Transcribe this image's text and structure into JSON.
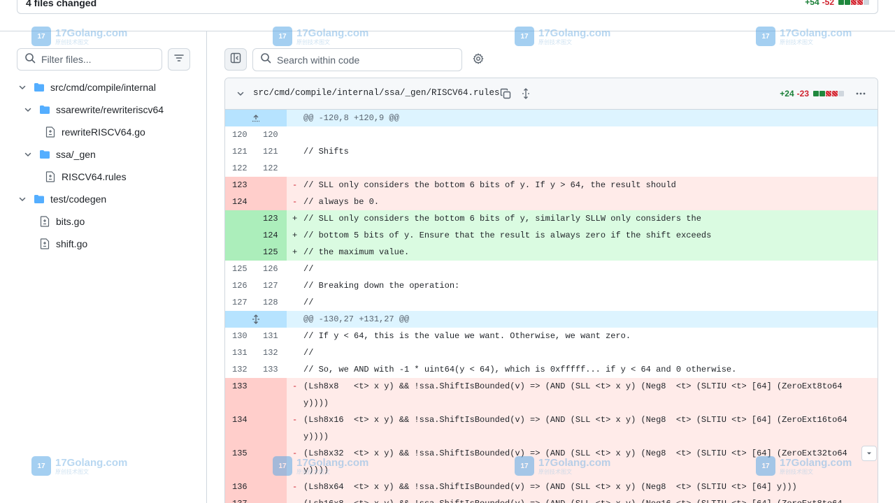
{
  "summary": {
    "files_changed": "4 files changed",
    "additions": "+54",
    "deletions": "-52"
  },
  "sidebar": {
    "filter_placeholder": "Filter files...",
    "tree": [
      {
        "label": "src/cmd/compile/internal",
        "type": "folder"
      },
      {
        "label": "ssarewrite/rewriteriscv64",
        "type": "folder"
      },
      {
        "label": "rewriteRISCV64.go",
        "type": "file"
      },
      {
        "label": "ssa/_gen",
        "type": "folder"
      },
      {
        "label": "RISCV64.rules",
        "type": "file"
      },
      {
        "label": "test/codegen",
        "type": "folder"
      },
      {
        "label": "bits.go",
        "type": "file"
      },
      {
        "label": "shift.go",
        "type": "file"
      }
    ]
  },
  "toolbar": {
    "search_placeholder": "Search within code"
  },
  "file": {
    "path": "src/cmd/compile/internal/ssa/_gen/RISCV64.rules",
    "additions": "+24",
    "deletions": "-23"
  },
  "diff_rows": [
    {
      "kind": "hunk",
      "old": "",
      "new": "",
      "sign": "",
      "code": "@@ -120,8 +120,9 @@"
    },
    {
      "kind": "ctx",
      "old": "120",
      "new": "120",
      "sign": "",
      "code": ""
    },
    {
      "kind": "ctx",
      "old": "121",
      "new": "121",
      "sign": "",
      "code": "// Shifts"
    },
    {
      "kind": "ctx",
      "old": "122",
      "new": "122",
      "sign": "",
      "code": ""
    },
    {
      "kind": "del",
      "old": "123",
      "new": "",
      "sign": "-",
      "code": "// SLL only considers the bottom 6 bits of y. If y > 64, the result should"
    },
    {
      "kind": "del",
      "old": "124",
      "new": "",
      "sign": "-",
      "code": "// always be 0."
    },
    {
      "kind": "add",
      "old": "",
      "new": "123",
      "sign": "+",
      "code": "// SLL only considers the bottom 6 bits of y, similarly SLLW only considers the"
    },
    {
      "kind": "add",
      "old": "",
      "new": "124",
      "sign": "+",
      "code": "// bottom 5 bits of y. Ensure that the result is always zero if the shift exceeds"
    },
    {
      "kind": "add",
      "old": "",
      "new": "125",
      "sign": "+",
      "code": "// the maximum value."
    },
    {
      "kind": "ctx",
      "old": "125",
      "new": "126",
      "sign": "",
      "code": "//"
    },
    {
      "kind": "ctx",
      "old": "126",
      "new": "127",
      "sign": "",
      "code": "// Breaking down the operation:"
    },
    {
      "kind": "ctx",
      "old": "127",
      "new": "128",
      "sign": "",
      "code": "//"
    },
    {
      "kind": "hunk",
      "old": "",
      "new": "",
      "sign": "",
      "code": "@@ -130,27 +131,27 @@"
    },
    {
      "kind": "ctx",
      "old": "130",
      "new": "131",
      "sign": "",
      "code": "// If y < 64, this is the value we want. Otherwise, we want zero."
    },
    {
      "kind": "ctx",
      "old": "131",
      "new": "132",
      "sign": "",
      "code": "//"
    },
    {
      "kind": "ctx",
      "old": "132",
      "new": "133",
      "sign": "",
      "code": "// So, we AND with -1 * uint64(y < 64), which is 0xfffff... if y < 64 and 0 otherwise."
    },
    {
      "kind": "del",
      "old": "133",
      "new": "",
      "sign": "-",
      "code": "(Lsh8x8   <t> x y) && !ssa.ShiftIsBounded(v) => (AND (SLL <t> x y) (Neg8  <t> (SLTIU <t> [64] (ZeroExt8to64\ny))))",
      "tall": true
    },
    {
      "kind": "del",
      "old": "134",
      "new": "",
      "sign": "-",
      "code": "(Lsh8x16  <t> x y) && !ssa.ShiftIsBounded(v) => (AND (SLL <t> x y) (Neg8  <t> (SLTIU <t> [64] (ZeroExt16to64\ny))))",
      "tall": true
    },
    {
      "kind": "del",
      "old": "135",
      "new": "",
      "sign": "-",
      "code": "(Lsh8x32  <t> x y) && !ssa.ShiftIsBounded(v) => (AND (SLL <t> x y) (Neg8  <t> (SLTIU <t> [64] (ZeroExt32to64\ny))))",
      "tall": true
    },
    {
      "kind": "del",
      "old": "136",
      "new": "",
      "sign": "-",
      "code": "(Lsh8x64  <t> x y) && !ssa.ShiftIsBounded(v) => (AND (SLL <t> x y) (Neg8  <t> (SLTIU <t> [64] y)))"
    },
    {
      "kind": "del",
      "old": "137",
      "new": "",
      "sign": "-",
      "code": "(Lsh16x8  <t> x y) && !ssa.ShiftIsBounded(v) => (AND (SLL <t> x y) (Neg16 <t> (SLTIU <t> [64] (ZeroExt8to64"
    }
  ],
  "watermark": {
    "title": "17Golang.com",
    "subtitle": "原创技术图文"
  },
  "colors": {
    "addition": "#1a7f37",
    "deletion": "#cf222e",
    "hunk_bg": "#ddf4ff",
    "del_bg": "#ffebe9",
    "add_bg": "#dafbe1"
  }
}
